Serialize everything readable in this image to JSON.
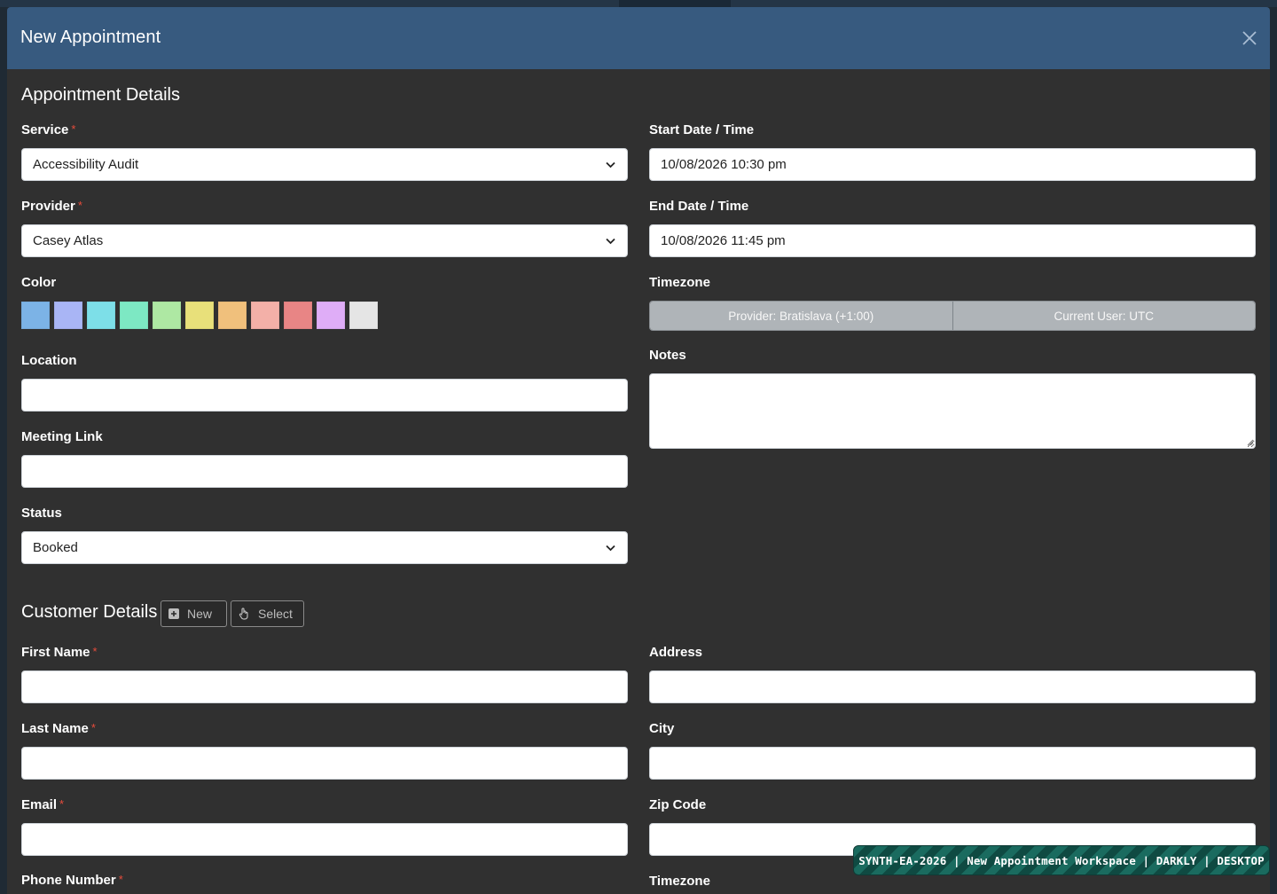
{
  "header": {
    "title": "New Appointment"
  },
  "appointment": {
    "title": "Appointment Details",
    "service": {
      "label": "Service",
      "value": "Accessibility Audit"
    },
    "provider": {
      "label": "Provider",
      "value": "Casey Atlas"
    },
    "color": {
      "label": "Color",
      "swatches": [
        "#7cb3e6",
        "#a9b5f5",
        "#7ddfe8",
        "#7de8c3",
        "#aee8a3",
        "#e8e07a",
        "#f0c07c",
        "#f3b0a8",
        "#e88585",
        "#dfadf7",
        "#e5e5e5"
      ]
    },
    "location": {
      "label": "Location",
      "value": ""
    },
    "meeting_link": {
      "label": "Meeting Link",
      "value": ""
    },
    "status": {
      "label": "Status",
      "value": "Booked"
    },
    "start": {
      "label": "Start Date / Time",
      "value": "10/08/2026 10:30 pm"
    },
    "end": {
      "label": "End Date / Time",
      "value": "10/08/2026 11:45 pm"
    },
    "timezone": {
      "label": "Timezone",
      "provider": "Provider: Bratislava (+1:00)",
      "current_user": "Current User: UTC"
    },
    "notes": {
      "label": "Notes",
      "value": ""
    }
  },
  "customer": {
    "title": "Customer Details",
    "new_label": "New",
    "select_label": "Select",
    "first_name": {
      "label": "First Name",
      "value": ""
    },
    "last_name": {
      "label": "Last Name",
      "value": ""
    },
    "email": {
      "label": "Email",
      "value": ""
    },
    "phone": {
      "label": "Phone Number"
    },
    "address": {
      "label": "Address",
      "value": ""
    },
    "city": {
      "label": "City",
      "value": ""
    },
    "zip": {
      "label": "Zip Code",
      "value": ""
    },
    "timezone": {
      "label": "Timezone"
    }
  },
  "required_mark": "*",
  "badge": "SYNTH-EA-2026 | New Appointment Workspace | DARKLY | DESKTOP"
}
